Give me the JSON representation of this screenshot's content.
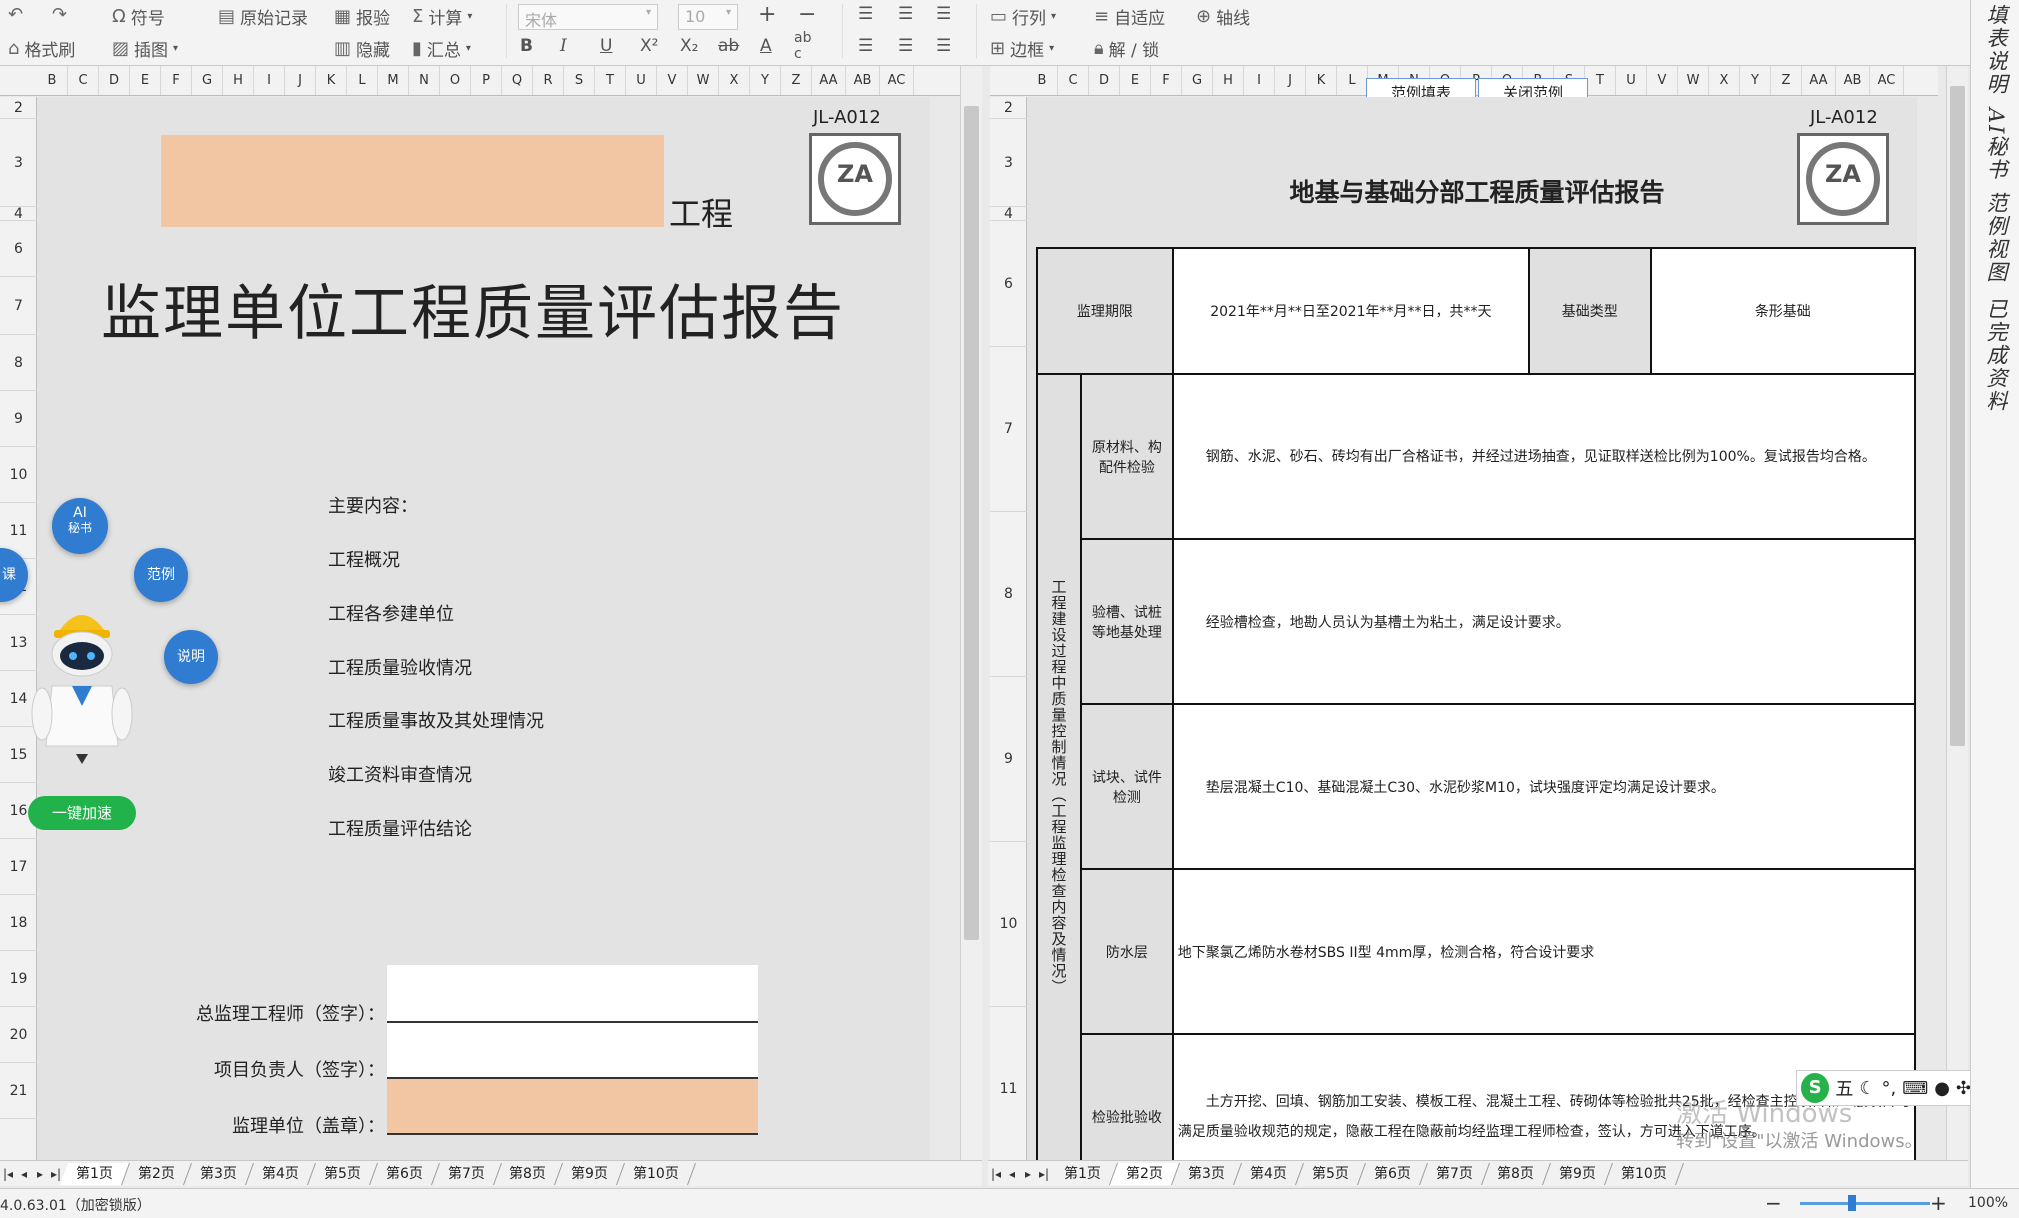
{
  "ribbon": {
    "row1": [
      "符号",
      "原始记录",
      "报验",
      "计算",
      "行列",
      "自适应",
      "轴线"
    ],
    "row2": [
      "格式刷",
      "插图",
      "隐藏",
      "汇总",
      "边框",
      "解 / 锁"
    ],
    "font_name": "宋体",
    "font_size": "10"
  },
  "grid": {
    "cols_left": [
      "B",
      "C",
      "D",
      "E",
      "F",
      "G",
      "H",
      "I",
      "J",
      "K",
      "L",
      "M",
      "N",
      "O",
      "P",
      "Q",
      "R",
      "S",
      "T",
      "U",
      "V",
      "W",
      "X",
      "Y",
      "Z",
      "AA",
      "AB",
      "AC"
    ],
    "cols_right": [
      "B",
      "C",
      "D",
      "E",
      "F",
      "G",
      "H",
      "I",
      "J",
      "K",
      "L",
      "M",
      "N",
      "O",
      "P",
      "Q",
      "R",
      "S",
      "T",
      "U",
      "V",
      "W",
      "X",
      "Y",
      "Z",
      "AA",
      "AB",
      "AC"
    ],
    "rows_left": [
      "2",
      "3",
      "4",
      "6",
      "7",
      "8",
      "9",
      "10",
      "11",
      "12",
      "13",
      "14",
      "15",
      "16",
      "17",
      "18",
      "19",
      "20",
      "21"
    ],
    "rows_right": [
      "2",
      "3",
      "4",
      "6",
      "7",
      "8",
      "9",
      "10",
      "11"
    ]
  },
  "left_sheet": {
    "code": "JL-A012",
    "suffix": "工程",
    "title": "监理单位工程质量评估报告",
    "contents_header": "主要内容：",
    "contents": [
      "工程概况",
      "工程各参建单位",
      "工程质量验收情况",
      "工程质量事故及其处理情况",
      "竣工资料审查情况",
      "工程质量评估结论"
    ],
    "signs": [
      "总监理工程师（签字）：",
      "项目负责人（签字）：",
      "监理单位（盖章）："
    ],
    "logo": "ZA"
  },
  "assistant": {
    "ai": "AI",
    "ai_sub": "秘书",
    "example": "范例",
    "explain": "说明",
    "course": "课",
    "speedup": "一键加速"
  },
  "right_sheet": {
    "code": "JL-A012",
    "title": "地基与基础分部工程质量评估报告",
    "logo": "ZA",
    "btn_fill": "范例填表",
    "btn_close": "关闭范例",
    "period_label": "监理期限",
    "period_value": "2021年**月**日至2021年**月**日，共**天",
    "type_label": "基础类型",
    "type_value": "条形基础",
    "side_label": "工程建设过程中质量控制情况（工程监理检查内容及情况）",
    "rows": [
      {
        "label": "原材料、构配件检验",
        "text": "钢筋、水泥、砂石、砖均有出厂合格证书，并经过进场抽查，见证取样送检比例为100%。复试报告均合格。"
      },
      {
        "label": "验槽、试桩等地基处理",
        "text": "经验槽检查，地勘人员认为基槽土为粘土，满足设计要求。"
      },
      {
        "label": "试块、试件检测",
        "text": "垫层混凝土C10、基础混凝土C30、水泥砂浆M10，试块强度评定均满足设计要求。"
      },
      {
        "label": "防水层",
        "text": "地下聚氯乙烯防水卷材SBS II型 4mm厚，检测合格，符合设计要求"
      },
      {
        "label": "检验批验收",
        "text": "土方开挖、回填、钢筋加工安装、模板工程、混凝土工程、砖砌体等检验批共25批，经检查主控项目和一般项目均满足质量验收规范的规定，隐蔽工程在隐蔽前均经监理工程师检查，签认，方可进入下道工序。"
      }
    ]
  },
  "tabs": [
    "第1页",
    "第2页",
    "第3页",
    "第4页",
    "第5页",
    "第6页",
    "第7页",
    "第8页",
    "第9页",
    "第10页"
  ],
  "side_panel": [
    "填表说明",
    "AI秘书",
    "范例视图",
    "已完成资料"
  ],
  "status": {
    "version": "4.0.63.01（加密锁版）",
    "zoom": "100%"
  },
  "watermark": {
    "line1": "激活 Windows",
    "line2": "转到\"设置\"以激活 Windows。"
  },
  "ime": {
    "label": "五"
  }
}
